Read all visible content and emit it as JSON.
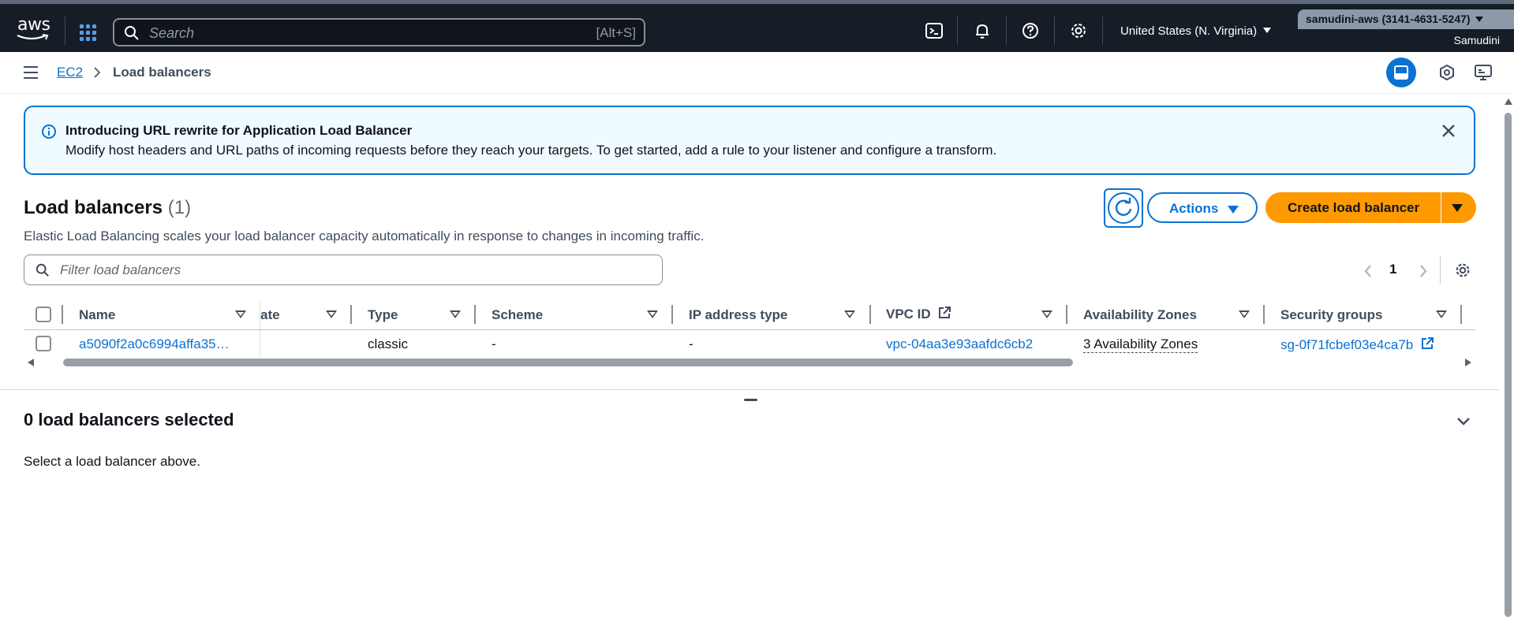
{
  "topnav": {
    "logo_text": "aws",
    "search_placeholder": "Search",
    "search_shortcut": "[Alt+S]",
    "icons": [
      "cloudshell-icon",
      "bell-icon",
      "help-icon",
      "gear-icon"
    ],
    "region": "United States (N. Virginia)",
    "account": "samudini-aws (3141-4631-5247)",
    "username": "Samudini"
  },
  "breadcrumb": {
    "parent": "EC2",
    "current": "Load balancers"
  },
  "flash": {
    "title": "Introducing URL rewrite for Application Load Balancer",
    "body": "Modify host headers and URL paths of incoming requests before they reach your targets. To get started, add a rule to your listener and configure a transform."
  },
  "header": {
    "title": "Load balancers",
    "count": "(1)",
    "description": "Elastic Load Balancing scales your load balancer capacity automatically in response to changes in incoming traffic.",
    "actions_label": "Actions",
    "create_label": "Create load balancer"
  },
  "filter": {
    "placeholder": "Filter load balancers"
  },
  "pagination": {
    "current_page": "1"
  },
  "table": {
    "columns": [
      "Name",
      "ate",
      "Type",
      "Scheme",
      "IP address type",
      "VPC ID",
      "Availability Zones",
      "Security groups"
    ],
    "rows": [
      {
        "name": "a5090f2a0c6994affa35…",
        "state": "",
        "type": "classic",
        "scheme": "-",
        "ip_address_type": "-",
        "vpc_id": "vpc-04aa3e93aafdc6cb2",
        "availability_zones": "3 Availability Zones",
        "security_groups": "sg-0f71fcbef03e4ca7b"
      }
    ]
  },
  "selection": {
    "title": "0 load balancers selected",
    "body": "Select a load balancer above."
  },
  "colors": {
    "nav_bg": "#161d26",
    "primary_blue": "#0972d3",
    "orange": "#ff9900",
    "info_bg": "#f0fbff"
  }
}
